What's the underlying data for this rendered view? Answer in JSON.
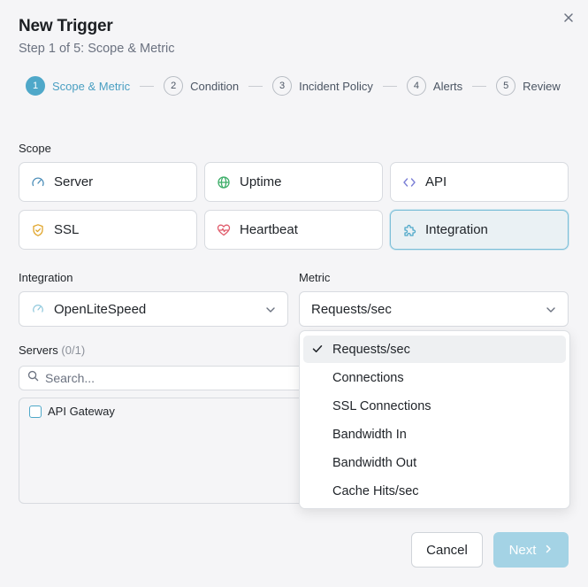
{
  "dialog": {
    "title": "New Trigger",
    "subtitle": "Step 1 of 5: Scope & Metric"
  },
  "stepper": [
    {
      "num": "1",
      "label": "Scope & Metric",
      "active": true
    },
    {
      "num": "2",
      "label": "Condition",
      "active": false
    },
    {
      "num": "3",
      "label": "Incident Policy",
      "active": false
    },
    {
      "num": "4",
      "label": "Alerts",
      "active": false
    },
    {
      "num": "5",
      "label": "Review",
      "active": false
    }
  ],
  "scope": {
    "label": "Scope",
    "options": [
      {
        "label": "Server",
        "icon": "gauge-icon",
        "selected": false
      },
      {
        "label": "Uptime",
        "icon": "globe-icon",
        "selected": false
      },
      {
        "label": "API",
        "icon": "code-icon",
        "selected": false
      },
      {
        "label": "SSL",
        "icon": "shield-check-icon",
        "selected": false
      },
      {
        "label": "Heartbeat",
        "icon": "heart-pulse-icon",
        "selected": false
      },
      {
        "label": "Integration",
        "icon": "puzzle-icon",
        "selected": true
      }
    ]
  },
  "integration": {
    "label": "Integration",
    "value": "OpenLiteSpeed",
    "icon": "gauge-icon"
  },
  "metric": {
    "label": "Metric",
    "value": "Requests/sec",
    "options": [
      {
        "label": "Requests/sec",
        "selected": true
      },
      {
        "label": "Connections",
        "selected": false
      },
      {
        "label": "SSL Connections",
        "selected": false
      },
      {
        "label": "Bandwidth In",
        "selected": false
      },
      {
        "label": "Bandwidth Out",
        "selected": false
      },
      {
        "label": "Cache Hits/sec",
        "selected": false
      }
    ]
  },
  "servers": {
    "label": "Servers",
    "count": "(0/1)",
    "search_placeholder": "Search...",
    "items": [
      {
        "label": "API Gateway",
        "checked": false
      }
    ]
  },
  "footer": {
    "cancel_label": "Cancel",
    "next_label": "Next"
  },
  "colors": {
    "accent": "#4fa8c9",
    "accent_disabled": "#a4d3e5",
    "background": "#f5f5f7",
    "border": "#d8dbe0"
  }
}
